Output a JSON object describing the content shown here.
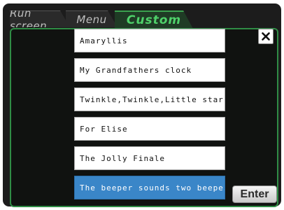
{
  "tabs": [
    {
      "label": "Run screen",
      "active": false
    },
    {
      "label": "Menu",
      "active": false
    },
    {
      "label": "Custom",
      "active": true
    }
  ],
  "colors": {
    "active_tab_text": "#4fd16a",
    "panel_border": "#2f8c45",
    "selected_item": "#3a86c8"
  },
  "close_button": {
    "icon": "close-icon",
    "glyph": "×"
  },
  "melodies": [
    {
      "label": "Amaryllis",
      "selected": false
    },
    {
      "label": "My Grandfathers clock",
      "selected": false
    },
    {
      "label": "Twinkle,Twinkle,Little star",
      "selected": false
    },
    {
      "label": "For Elise",
      "selected": false
    },
    {
      "label": "The Jolly Finale",
      "selected": false
    },
    {
      "label": "The beeper sounds two beepes",
      "selected": true
    }
  ],
  "enter_button": {
    "label": "Enter"
  }
}
